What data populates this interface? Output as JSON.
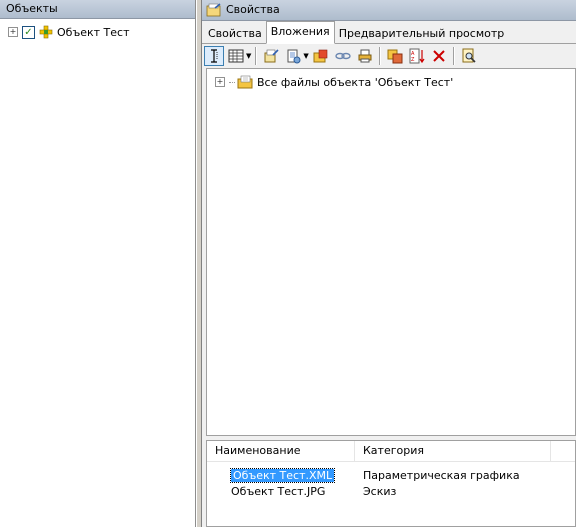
{
  "left_panel": {
    "title": "Объекты",
    "tree": [
      {
        "label": "Объект Тест",
        "expander": "+",
        "checked": true
      }
    ]
  },
  "right_panel": {
    "title": "Свойства",
    "tabs": [
      "Свойства",
      "Вложения",
      "Предварительный просмотр"
    ],
    "active_tab": "Вложения",
    "toolbar": [
      "text-cursor-icon",
      "columns-icon",
      "edit-properties-icon",
      "open-file-icon",
      "folder-add-icon",
      "link-icon",
      "print-icon",
      "copy-move-icon",
      "sort-az-icon",
      "delete-icon",
      "find-icon"
    ],
    "files_tree": {
      "root_label": "Все файлы объекта 'Объект Тест'",
      "expander": "+"
    },
    "list": {
      "columns": [
        "Наименование",
        "Категория"
      ],
      "rows": [
        {
          "name": "Объект Тест.XML",
          "category": "Параметрическая графика",
          "selected": true
        },
        {
          "name": "Объект Тест.JPG",
          "category": "Эскиз",
          "selected": false
        }
      ]
    }
  },
  "colors": {
    "header_gradient_top": "#c9d3e0",
    "header_gradient_bottom": "#aebccd",
    "selection": "#3399ff",
    "delete_icon": "#cc0000"
  }
}
